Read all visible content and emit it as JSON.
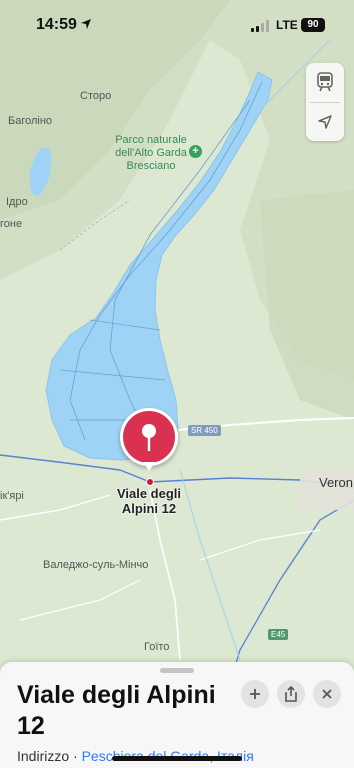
{
  "status_bar": {
    "time": "14:59",
    "network": "LTE",
    "battery": "90"
  },
  "map": {
    "labels": {
      "storo": "Сторо",
      "bagolino": "Баголіно",
      "idro": "Ідро",
      "gone": "гоне",
      "park": "Parco naturale dell'Alto Garda Bresciano",
      "verona": "Veron",
      "chiari": "ік'ярі",
      "valeggio": "Валеджо-суль-Мінчо",
      "goito": "Гоїто"
    },
    "roads": {
      "sr450": "SR 450",
      "e45": "E45"
    },
    "pin": {
      "label": "Viale degli Alpini 12"
    }
  },
  "controls": {
    "transit": "transit-icon",
    "location": "location-arrow-icon"
  },
  "sheet": {
    "title": "Viale degli Alpini 12",
    "subtitle_prefix": "Indirizzo · ",
    "subtitle_link": "Peschiera del Garda, Італія"
  },
  "colors": {
    "water": "#9fd3f5",
    "pin": "#d93251",
    "link": "#2f7bf5"
  }
}
